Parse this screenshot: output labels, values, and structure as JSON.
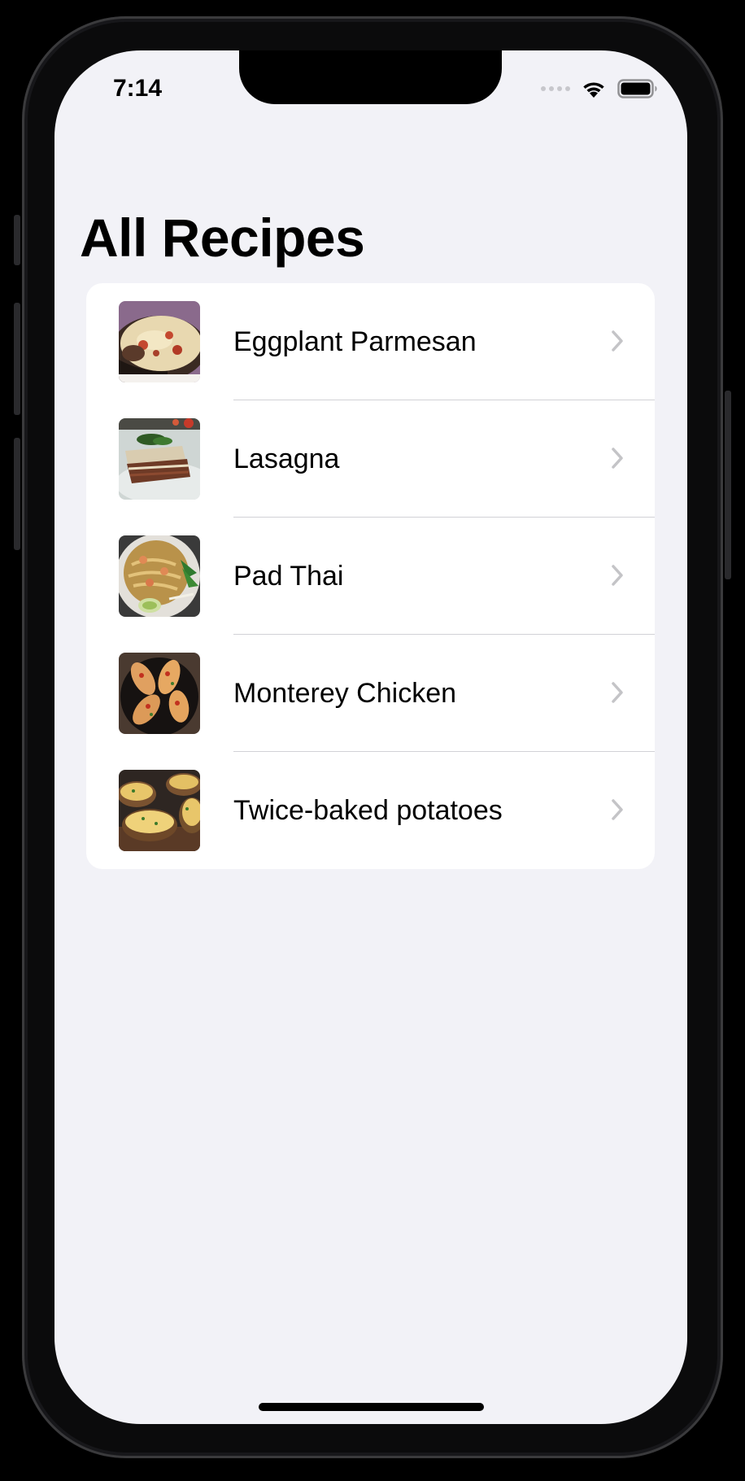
{
  "status_bar": {
    "time": "7:14",
    "icons": [
      "cellular-dots-icon",
      "wifi-icon",
      "battery-icon"
    ]
  },
  "page": {
    "title": "All Recipes"
  },
  "recipes": [
    {
      "name": "Eggplant Parmesan",
      "image": "eggplant-parmesan-photo"
    },
    {
      "name": "Lasagna",
      "image": "lasagna-photo"
    },
    {
      "name": "Pad Thai",
      "image": "pad-thai-photo"
    },
    {
      "name": "Monterey Chicken",
      "image": "monterey-chicken-photo"
    },
    {
      "name": "Twice-baked potatoes",
      "image": "twice-baked-potatoes-photo"
    }
  ],
  "colors": {
    "background": "#f2f2f7",
    "card": "#ffffff",
    "separator": "#d1d1d6",
    "chevron": "#c4c4c7",
    "text": "#000000"
  }
}
